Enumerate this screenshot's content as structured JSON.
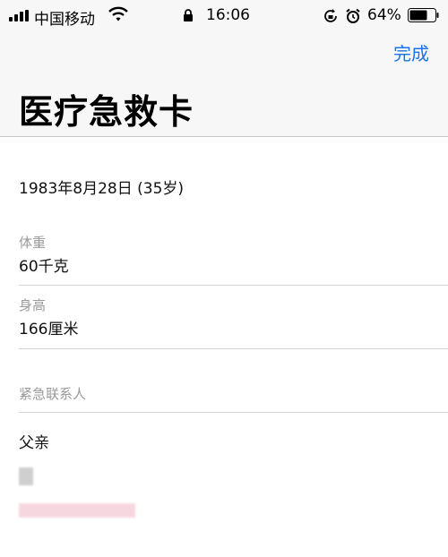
{
  "status_bar": {
    "carrier": "中国移动",
    "time": "16:06",
    "battery": "64%",
    "icons": [
      "signal-icon",
      "wifi-icon",
      "lock-icon",
      "rotation-lock-icon",
      "alarm-icon",
      "battery-icon"
    ]
  },
  "nav": {
    "done_label": "完成"
  },
  "page": {
    "title": "医疗急救卡"
  },
  "birthday": {
    "value": "1983年8月28日 (35岁)"
  },
  "weight": {
    "label": "体重",
    "value": "60千克"
  },
  "height": {
    "label": "身高",
    "value": "166厘米"
  },
  "emergency": {
    "label": "紧急联系人",
    "relation": "父亲"
  },
  "colors": {
    "accent": "#1a73e8",
    "label": "#9a9a9a",
    "separator": "#d6d6d6"
  }
}
